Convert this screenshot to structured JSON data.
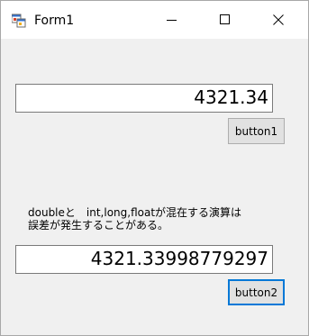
{
  "window": {
    "title": "Form1",
    "app_icon": "winforms-app-icon",
    "controls": {
      "minimize_icon": "minimize-icon",
      "maximize_icon": "maximize-icon",
      "close_icon": "close-icon"
    }
  },
  "textbox1": {
    "value": "4321.34"
  },
  "button1": {
    "label": "button1"
  },
  "description": {
    "text": "doubleと　int,long,floatが混在する演算は\n誤差が発生することがある。"
  },
  "textbox2": {
    "value": "4321.33998779297"
  },
  "button2": {
    "label": "button2"
  },
  "colors": {
    "focus_border": "#0078d7",
    "window_bg": "#f0f0f0",
    "titlebar_bg": "#ffffff"
  }
}
